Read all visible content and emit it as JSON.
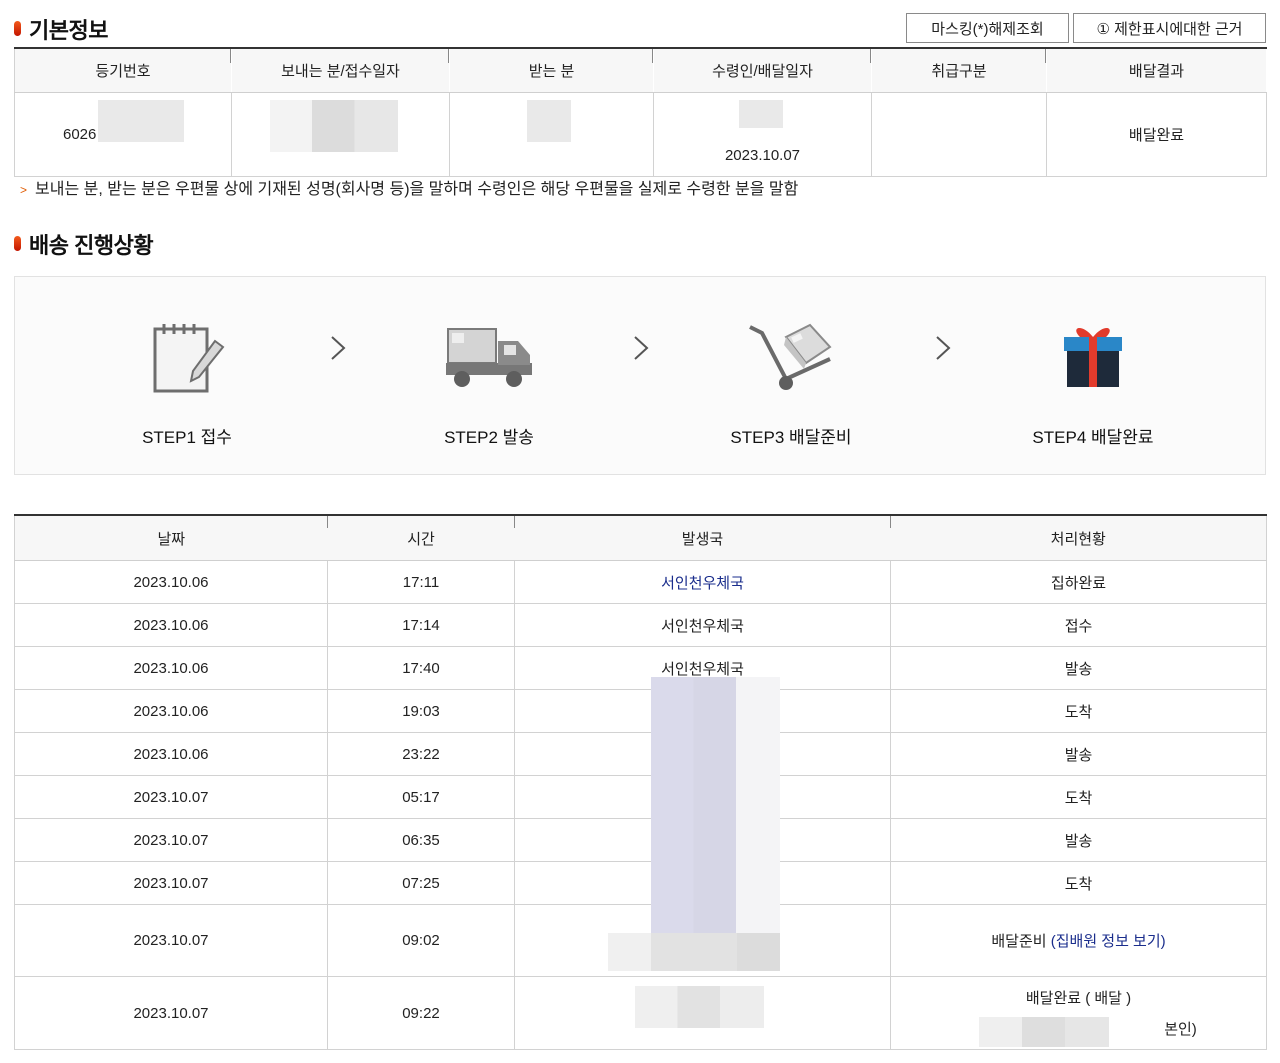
{
  "basic_info": {
    "title": "기본정보",
    "masking_button": "마스킹(*)해제조회",
    "restriction_button": "① 제한표시에대한 근거",
    "columns": [
      "등기번호",
      "보내는 분/접수일자",
      "받는 분",
      "수령인/배달일자",
      "취급구분",
      "배달결과"
    ],
    "row": {
      "reg_number_prefix": "6026",
      "sender": "",
      "receiver": "",
      "delivery_date": "2023.10.07",
      "handling": "",
      "result": "배달완료"
    },
    "note": "보내는 분, 받는 분은 우편물 상에 기재된 성명(회사명 등)을 말하며 수령인은 해당 우편물을 실제로 수령한 분을 말함"
  },
  "progress": {
    "title": "배송 진행상황",
    "steps": [
      {
        "label": "STEP1 접수",
        "icon": "notepad-icon"
      },
      {
        "label": "STEP2 발송",
        "icon": "truck-icon"
      },
      {
        "label": "STEP3 배달준비",
        "icon": "hand-cart-icon"
      },
      {
        "label": "STEP4 배달완료",
        "icon": "gift-box-icon"
      }
    ],
    "arrow": "›"
  },
  "history": {
    "columns": [
      "날짜",
      "시간",
      "발생국",
      "처리현황"
    ],
    "rows": [
      {
        "date": "2023.10.06",
        "time": "17:11",
        "office": "서인천우체국",
        "status": "집하완료"
      },
      {
        "date": "2023.10.06",
        "time": "17:14",
        "office": "서인천우체국",
        "status": "접수"
      },
      {
        "date": "2023.10.06",
        "time": "17:40",
        "office": "서인천우체국",
        "status": "발송"
      },
      {
        "date": "2023.10.06",
        "time": "19:03",
        "office": "",
        "status": "도착"
      },
      {
        "date": "2023.10.06",
        "time": "23:22",
        "office": "",
        "status": "발송"
      },
      {
        "date": "2023.10.07",
        "time": "05:17",
        "office": "",
        "status": "도착"
      },
      {
        "date": "2023.10.07",
        "time": "06:35",
        "office": "",
        "status": "발송"
      },
      {
        "date": "2023.10.07",
        "time": "07:25",
        "office": "",
        "status": "도착"
      },
      {
        "date": "2023.10.07",
        "time": "09:02",
        "office": "",
        "status": "배달준비",
        "link": "(집배원 정보 보기)"
      },
      {
        "date": "2023.10.07",
        "time": "09:22",
        "office": "",
        "status": "배달완료 ( 배달 )",
        "status_suffix": "본인)"
      }
    ]
  },
  "colors": {
    "accent_bullet": "#d9300a",
    "link": "#1a2d8c",
    "header_rule": "#333333"
  }
}
